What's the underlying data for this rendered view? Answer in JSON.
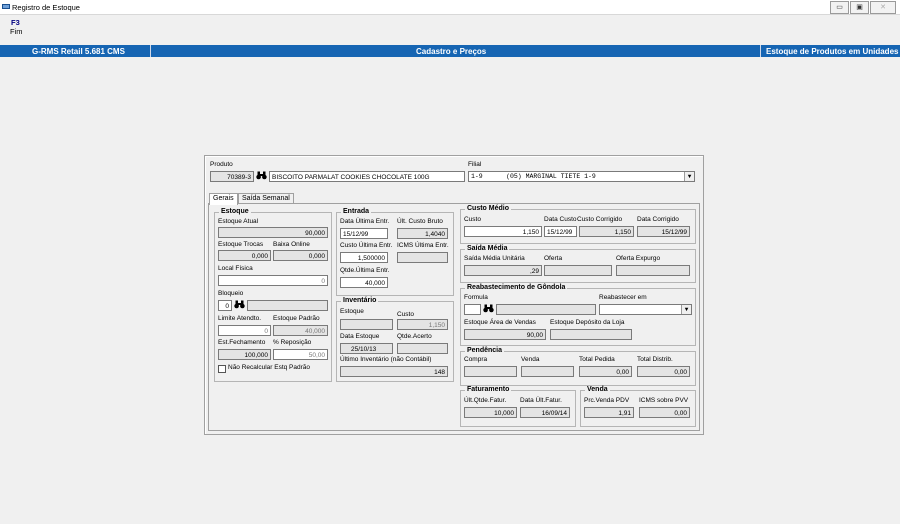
{
  "window": {
    "title": "Registro de Estoque",
    "min": "▭",
    "max": "▣",
    "close": "✕"
  },
  "menu": {
    "key": "F3",
    "label": "Fim"
  },
  "header": {
    "left": "G-RMS Retail 5.681 CMS",
    "center": "Cadastro e Preços",
    "right": "Estoque de Produtos em Unidades"
  },
  "produto": {
    "label": "Produto",
    "code": "70389-3",
    "description": "BISCOITO PARMALAT COOKIES CHOCOLATE 100G"
  },
  "filial": {
    "label": "Filial",
    "value": "1-9      (05) MARGINAL TIETE 1-9"
  },
  "tabs": [
    "Gerais",
    "Saída Semanal"
  ],
  "estoque": {
    "title": "Estoque",
    "atual_label": "Estoque Atual",
    "atual": "90,000",
    "trocas_label": "Estoque Trocas",
    "trocas": "0,000",
    "baixa_label": "Baixa Online",
    "baixa": "0,000",
    "local_label": "Local Física",
    "local": "0",
    "bloqueio_label": "Bloqueio",
    "bloqueio": "0",
    "limite_label": "Limite Atendto.",
    "limite": "0",
    "padrao_label": "Estoque Padrão",
    "padrao": "40,000",
    "fechamento_label": "Est.Fechamento",
    "fechamento": "100,000",
    "reposicao_label": "% Reposição",
    "reposicao": "50,00",
    "recalcular_label": "Não Recalcular Estq Padrão"
  },
  "entrada": {
    "title": "Entrada",
    "data_label": "Data Última Entr.",
    "data": "15/12/99",
    "custo_bruto_label": "Últ. Custo Bruto",
    "custo_bruto": "1,4040",
    "custo_ult_label": "Custo Última Entr.",
    "custo_ult": "1,500000",
    "icms_label": "ICMS Última Entr.",
    "qtde_label": "Qtde.Última Entr.",
    "qtde": "40,000"
  },
  "inventario": {
    "title": "Inventário",
    "estoque_label": "Estoque",
    "custo_label": "Custo",
    "custo": "1,150",
    "data_label": "Data Estoque",
    "data": "25/10/13",
    "acerto_label": "Qtde.Acerto",
    "ultimo_label": "Último Inventário (não Contábil)",
    "ultimo": "148"
  },
  "custo_medio": {
    "title": "Custo Médio",
    "custo_label": "Custo",
    "custo": "1,150",
    "data_label": "Data Custo",
    "data": "15/12/99",
    "corrigido_label": "Custo Corrigido",
    "corrigido": "1,150",
    "data_corr_label": "Data Corrigido",
    "data_corr": "15/12/99"
  },
  "saida_media": {
    "title": "Saída Média",
    "unitaria_label": "Saída Média Unitária",
    "unitaria": ",29",
    "oferta_label": "Oferta",
    "expurgo_label": "Oferta Expurgo"
  },
  "reabastecimento": {
    "title": "Reabastecimento de Gôndola",
    "formula_label": "Formula",
    "reabastecer_label": "Reabastecer em",
    "area_label": "Estoque Área de Vendas",
    "area": "90,00",
    "deposito_label": "Estoque Depósito da Loja"
  },
  "pendencia": {
    "title": "Pendência",
    "compra_label": "Compra",
    "venda_label": "Venda",
    "total_pedida_label": "Total Pedida",
    "total_pedida": "0,00",
    "total_distrib_label": "Total  Distrib.",
    "total_distrib": "0,00"
  },
  "faturamento": {
    "title": "Faturamento",
    "qtde_label": "Últ.Qtde.Fatur.",
    "qtde": "10,000",
    "data_label": "Data Últ.Fatur.",
    "data": "16/09/14"
  },
  "venda": {
    "title": "Venda",
    "pdv_label": "Prc.Venda PDV",
    "pdv": "1,91",
    "icms_label": "ICMS sobre PVV",
    "icms": "0,00"
  },
  "icons": {
    "app": "app-icon",
    "find": "binoculars-icon",
    "dropdown": "chevron-down-icon"
  }
}
